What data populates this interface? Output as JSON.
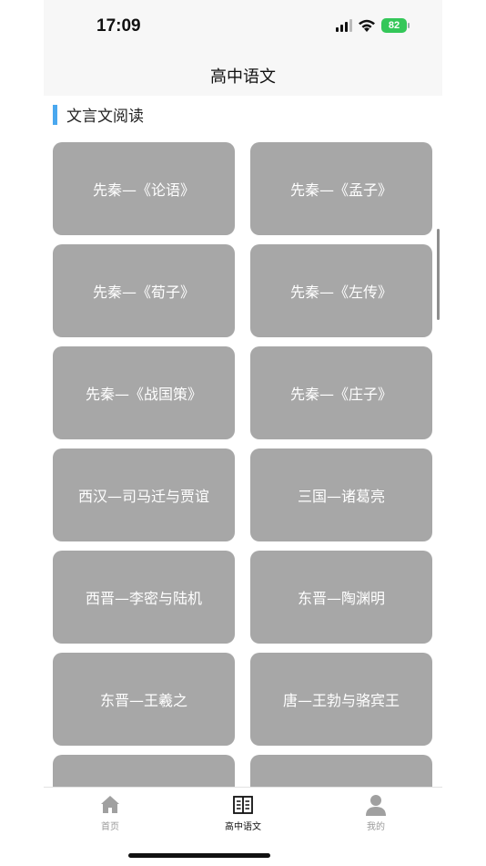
{
  "status_bar": {
    "time": "17:09",
    "battery": "82"
  },
  "header": {
    "title": "高中语文"
  },
  "section": {
    "title": "文言文阅读",
    "accent_color": "#4aa8ef"
  },
  "cards": [
    {
      "label": "先秦—《论语》"
    },
    {
      "label": "先秦—《孟子》"
    },
    {
      "label": "先秦—《荀子》"
    },
    {
      "label": "先秦—《左传》"
    },
    {
      "label": "先秦—《战国策》"
    },
    {
      "label": "先秦—《庄子》"
    },
    {
      "label": "西汉—司马迁与贾谊"
    },
    {
      "label": "三国—诸葛亮"
    },
    {
      "label": "西晋—李密与陆机"
    },
    {
      "label": "东晋—陶渊明"
    },
    {
      "label": "东晋—王羲之"
    },
    {
      "label": "唐—王勃与骆宾王"
    },
    {
      "label": ""
    },
    {
      "label": ""
    }
  ],
  "tab_bar": {
    "items": [
      {
        "label": "首页",
        "icon": "home-icon",
        "active": false
      },
      {
        "label": "高中语文",
        "icon": "book-icon",
        "active": true
      },
      {
        "label": "我的",
        "icon": "person-icon",
        "active": false
      }
    ]
  },
  "colors": {
    "card_background": "#a7a7a7",
    "card_text": "#ffffff",
    "battery": "#34c759"
  }
}
